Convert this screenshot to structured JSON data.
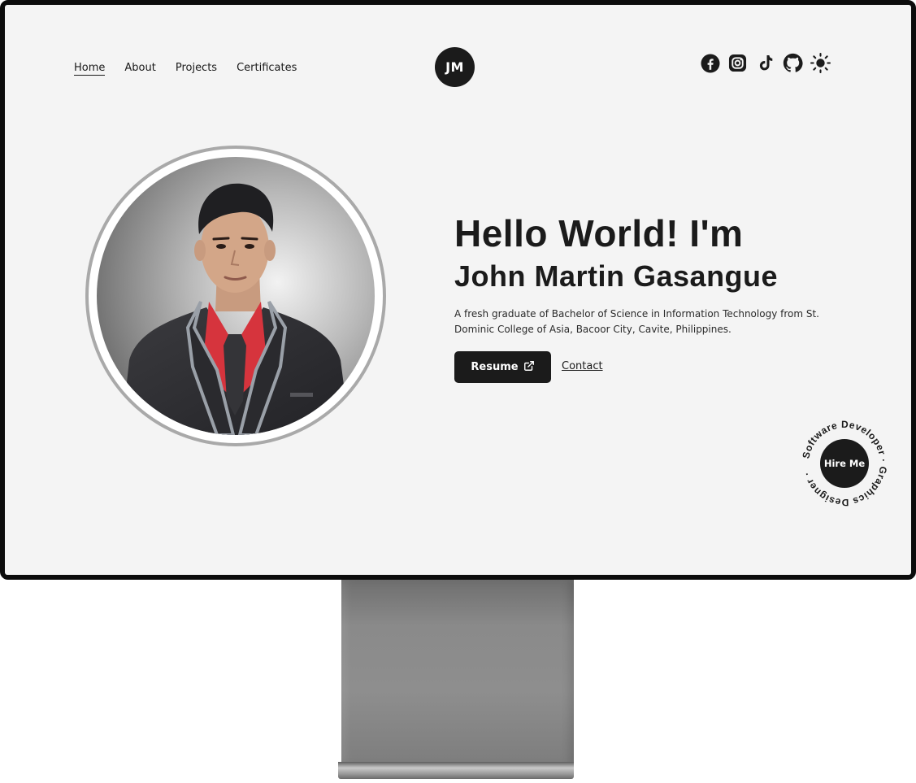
{
  "nav": {
    "items": [
      {
        "label": "Home",
        "active": true
      },
      {
        "label": "About",
        "active": false
      },
      {
        "label": "Projects",
        "active": false
      },
      {
        "label": "Certificates",
        "active": false
      }
    ]
  },
  "logo": {
    "text": "JM"
  },
  "social": {
    "icons": [
      "facebook-icon",
      "instagram-icon",
      "tiktok-icon",
      "github-icon",
      "theme-toggle-sun-icon"
    ]
  },
  "hero": {
    "greeting": "Hello World! I'm",
    "name": "John Martin Gasangue",
    "description": "A fresh graduate of Bachelor of Science in Information Technology from St. Dominic College of Asia, Bacoor City, Cavite, Philippines.",
    "resume_label": "Resume",
    "contact_label": "Contact"
  },
  "hire": {
    "label": "Hire Me",
    "ring_text": "Software Developer · Graphics Designer ·"
  },
  "colors": {
    "screen_bg": "#f4f4f4",
    "dark": "#1b1b1b",
    "ring": "#a9a9a9"
  }
}
